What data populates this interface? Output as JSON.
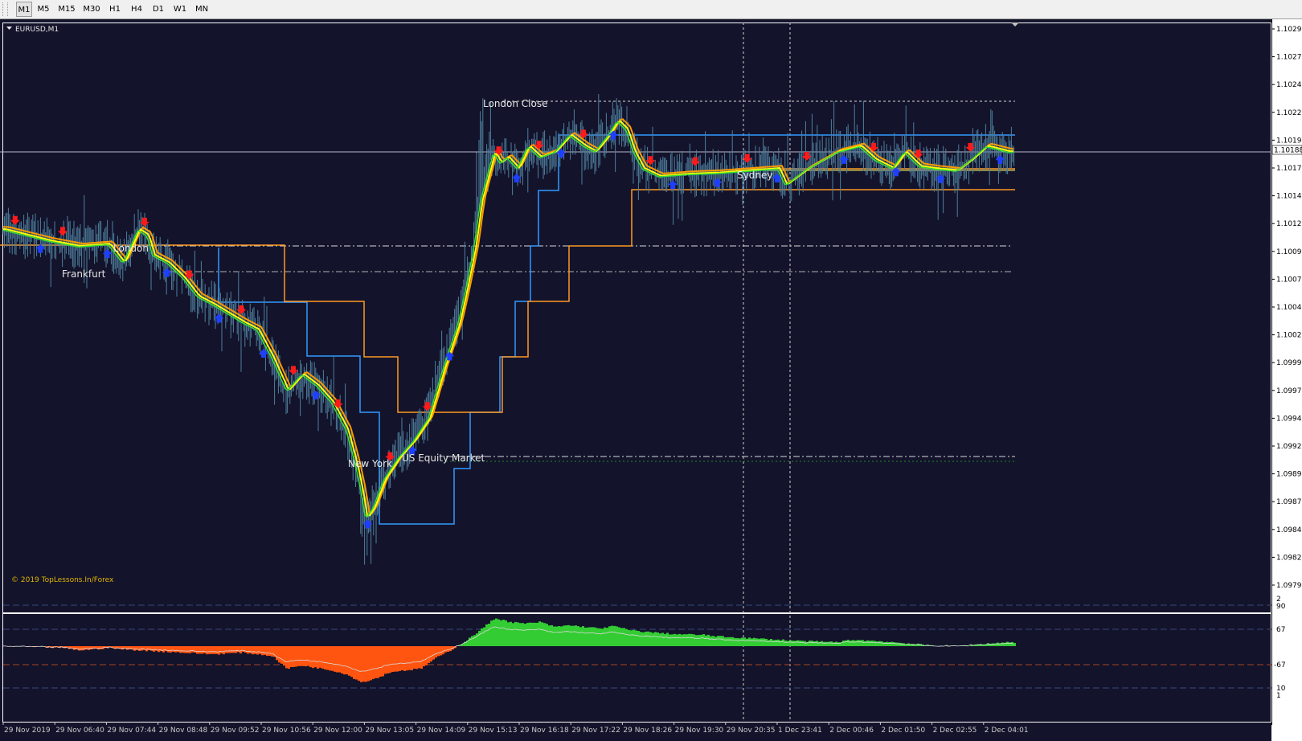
{
  "toolbar": {
    "timeframes": [
      "M1",
      "M5",
      "M15",
      "M30",
      "H1",
      "H4",
      "D1",
      "W1",
      "MN"
    ],
    "active": "M1"
  },
  "chart": {
    "symbol_label": "EURUSD,M1",
    "current_price": "1.10188",
    "copyright": "© 2019 TopLessons.In/Forex",
    "sessions": [
      "London Close",
      "London",
      "Frankfurt",
      "New York",
      "US Equity Market",
      "Sydney"
    ],
    "colors": {
      "background": "#13132b",
      "grid_text": "#c9c9c9",
      "ma_yellow": "#ffff00",
      "ma_orange": "#ff9900",
      "ma_green": "#33dd33",
      "level_blue": "#3399ff",
      "level_orange": "#ff9922",
      "arrow_up": "#1f3fff",
      "arrow_down": "#ff1a1a",
      "hist_positive": "#33cc33",
      "hist_negative": "#ff5511"
    }
  },
  "indicator": {
    "levels": [
      "2",
      "90",
      "67",
      "-67",
      "10",
      "1"
    ]
  },
  "chart_data": {
    "type": "line",
    "symbol": "EURUSD",
    "timeframe": "M1",
    "y_ticks": [
      "1.10295",
      "1.10270",
      "1.10245",
      "1.10220",
      "1.10195",
      "1.10170",
      "1.10145",
      "1.10120",
      "1.10095",
      "1.10070",
      "1.10045",
      "1.10020",
      "1.09995",
      "1.09970",
      "1.09945",
      "1.09920",
      "1.09895",
      "1.09870",
      "1.09845",
      "1.09820",
      "1.09795"
    ],
    "x_ticks": [
      "29 Nov 2019",
      "29 Nov 06:40",
      "29 Nov 07:44",
      "29 Nov 08:48",
      "29 Nov 09:52",
      "29 Nov 10:56",
      "29 Nov 12:00",
      "29 Nov 13:05",
      "29 Nov 14:09",
      "29 Nov 15:13",
      "29 Nov 16:18",
      "29 Nov 17:22",
      "29 Nov 18:26",
      "29 Nov 19:30",
      "29 Nov 20:35",
      "1 Dec 23:41",
      "2 Dec 00:46",
      "2 Dec 01:50",
      "2 Dec 02:55",
      "2 Dec 04:01"
    ],
    "ylim": [
      1.10295,
      1.09795
    ],
    "price_series": [
      [
        0,
        1.10115
      ],
      [
        3,
        1.10105
      ],
      [
        5,
        1.101
      ],
      [
        7,
        1.10102
      ],
      [
        8,
        1.10085
      ],
      [
        9,
        1.10115
      ],
      [
        9.6,
        1.1011
      ],
      [
        10,
        1.10092
      ],
      [
        11,
        1.10085
      ],
      [
        12,
        1.10072
      ],
      [
        13,
        1.10055
      ],
      [
        14,
        1.10048
      ],
      [
        15,
        1.1004
      ],
      [
        16,
        1.10032
      ],
      [
        17,
        1.10025
      ],
      [
        18,
        1.1
      ],
      [
        19,
        1.0997
      ],
      [
        20,
        1.09985
      ],
      [
        21,
        1.09975
      ],
      [
        22,
        1.0996
      ],
      [
        23,
        1.09935
      ],
      [
        23.6,
        1.09905
      ],
      [
        24,
        1.0988
      ],
      [
        24.3,
        1.09855
      ],
      [
        24.8,
        1.09865
      ],
      [
        25.5,
        1.0989
      ],
      [
        26.5,
        1.0991
      ],
      [
        27.5,
        1.09925
      ],
      [
        28.5,
        1.09945
      ],
      [
        29.5,
        1.0999
      ],
      [
        30.5,
        1.1003
      ],
      [
        31,
        1.1006
      ],
      [
        31.6,
        1.101
      ],
      [
        32,
        1.1014
      ],
      [
        32.5,
        1.10165
      ],
      [
        32.9,
        1.10185
      ],
      [
        33.3,
        1.10175
      ],
      [
        33.8,
        1.1018
      ],
      [
        34.5,
        1.1017
      ],
      [
        35.2,
        1.1019
      ],
      [
        36,
        1.1018
      ],
      [
        37,
        1.10185
      ],
      [
        38,
        1.102
      ],
      [
        39,
        1.1019
      ],
      [
        39.7,
        1.10185
      ],
      [
        40.6,
        1.102
      ],
      [
        41.2,
        1.10213
      ],
      [
        41.8,
        1.10205
      ],
      [
        42.3,
        1.10185
      ],
      [
        42.9,
        1.1017
      ],
      [
        44,
        1.10163
      ],
      [
        46,
        1.10165
      ],
      [
        48,
        1.10166
      ],
      [
        50,
        1.10168
      ],
      [
        52,
        1.1017
      ],
      [
        52.5,
        1.10155
      ],
      [
        53,
        1.1016
      ],
      [
        54,
        1.1017
      ],
      [
        56,
        1.10185
      ],
      [
        57.5,
        1.1019
      ],
      [
        58.5,
        1.10178
      ],
      [
        59.7,
        1.1017
      ],
      [
        60.5,
        1.10185
      ],
      [
        61.5,
        1.10172
      ],
      [
        62.5,
        1.1017
      ],
      [
        64,
        1.10168
      ],
      [
        65,
        1.10178
      ],
      [
        66,
        1.1019
      ],
      [
        67.5,
        1.10185
      ]
    ],
    "oscillator_series": [
      [
        0,
        0
      ],
      [
        4,
        -2
      ],
      [
        5,
        -5
      ],
      [
        6,
        -4
      ],
      [
        7,
        -2
      ],
      [
        8,
        -4
      ],
      [
        10,
        -6
      ],
      [
        12,
        -8
      ],
      [
        14,
        -10
      ],
      [
        16,
        -8
      ],
      [
        18,
        -12
      ],
      [
        19,
        -28
      ],
      [
        20,
        -24
      ],
      [
        22,
        -30
      ],
      [
        23,
        -35
      ],
      [
        24,
        -45
      ],
      [
        25,
        -40
      ],
      [
        26,
        -32
      ],
      [
        28,
        -28
      ],
      [
        29,
        -15
      ],
      [
        30,
        -5
      ],
      [
        31,
        6
      ],
      [
        32,
        20
      ],
      [
        33,
        35
      ],
      [
        34,
        30
      ],
      [
        35,
        28
      ],
      [
        36,
        30
      ],
      [
        37,
        24
      ],
      [
        38,
        26
      ],
      [
        40,
        22
      ],
      [
        41,
        25
      ],
      [
        42,
        20
      ],
      [
        43,
        18
      ],
      [
        45,
        15
      ],
      [
        47,
        14
      ],
      [
        48,
        12
      ],
      [
        50,
        10
      ],
      [
        52,
        8
      ],
      [
        54,
        6
      ],
      [
        56,
        5
      ],
      [
        57,
        8
      ],
      [
        59,
        6
      ],
      [
        61,
        3
      ],
      [
        62,
        1
      ],
      [
        64,
        0
      ],
      [
        66,
        3
      ],
      [
        67.5,
        5
      ]
    ]
  }
}
